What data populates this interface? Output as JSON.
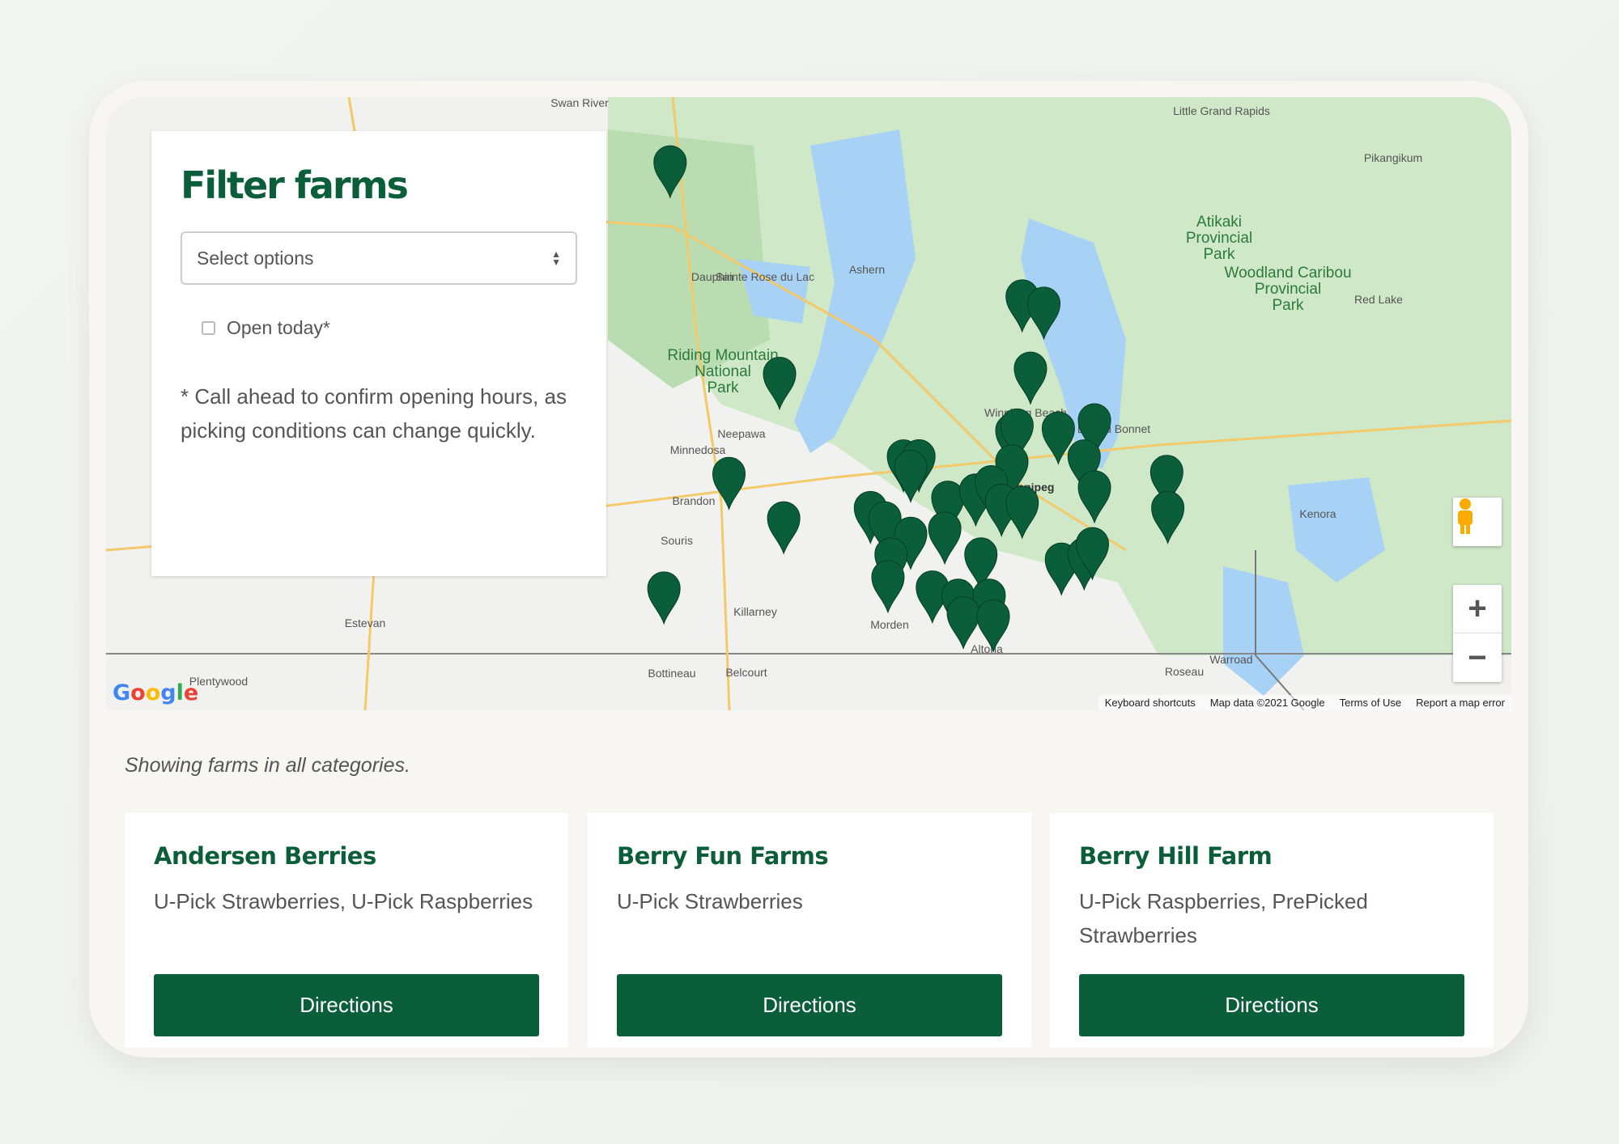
{
  "filter": {
    "title": "Filter farms",
    "select_placeholder": "Select options",
    "open_today_label": "Open today*",
    "open_today_checked": false,
    "note": "* Call ahead to confirm opening hours, as picking conditions can change quickly."
  },
  "status": "Showing farms in all categories.",
  "farms": [
    {
      "name": "Andersen Berries",
      "categories": "U-Pick Strawberries, U-Pick Raspberries",
      "button": "Directions"
    },
    {
      "name": "Berry Fun Farms",
      "categories": "U-Pick Strawberries",
      "button": "Directions"
    },
    {
      "name": "Berry Hill Farm",
      "categories": "U-Pick Raspberries, PrePicked Strawberries",
      "button": "Directions"
    }
  ],
  "map": {
    "marker_color": "#0b5e3a",
    "labels": [
      "Swan River",
      "Little Grand Rapids",
      "Pikangikum",
      "Dauphin",
      "Sainte Rose du Lac",
      "Ashern",
      "Neepawa",
      "Minnedosa",
      "Brandon",
      "Souris",
      "Killarney",
      "Morden",
      "Altona",
      "Winnipeg",
      "Lac du Bonnet",
      "Kenora",
      "Roseau",
      "Warroad",
      "Estevan",
      "Bottineau",
      "Belcourt",
      "Plentywood",
      "Red Lake",
      "Winnipeg Beach"
    ],
    "parks": [
      "Riding Mountain National Park",
      "Atikaki Provincial Park",
      "Woodland Caribou Provincial Park"
    ],
    "footer": {
      "keyboard": "Keyboard shortcuts",
      "data": "Map data ©2021 Google",
      "terms": "Terms of Use",
      "report": "Report a map error"
    },
    "logo": "Google",
    "zoom_in": "+",
    "zoom_out": "−"
  }
}
